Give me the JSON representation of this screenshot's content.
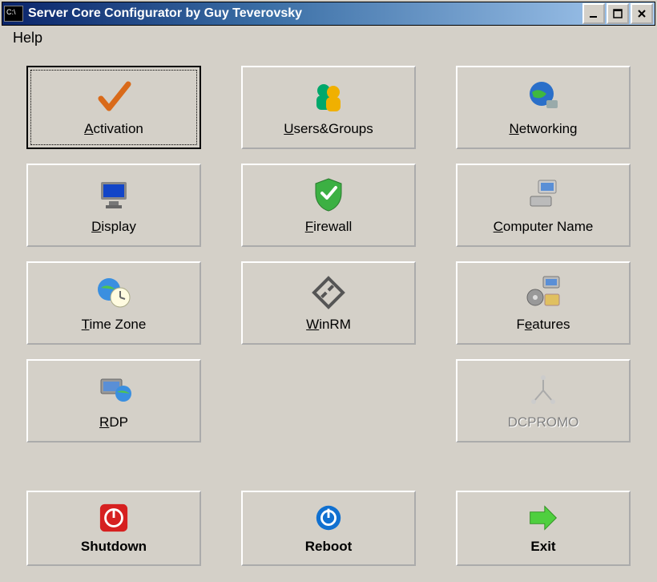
{
  "window_title": "Server Core Configurator by Guy Teverovsky",
  "menu": {
    "help": "Help"
  },
  "buttons": {
    "activation": "Activation",
    "users_groups": "Users&Groups",
    "networking": "Networking",
    "display": "Display",
    "firewall": "Firewall",
    "computer_name": "Computer Name",
    "time_zone": "Time Zone",
    "winrm": "WinRM",
    "features": "Features",
    "rdp": "RDP",
    "dcpromo": "DCPROMO"
  },
  "actions": {
    "shutdown": "Shutdown",
    "reboot": "Reboot",
    "exit": "Exit"
  }
}
